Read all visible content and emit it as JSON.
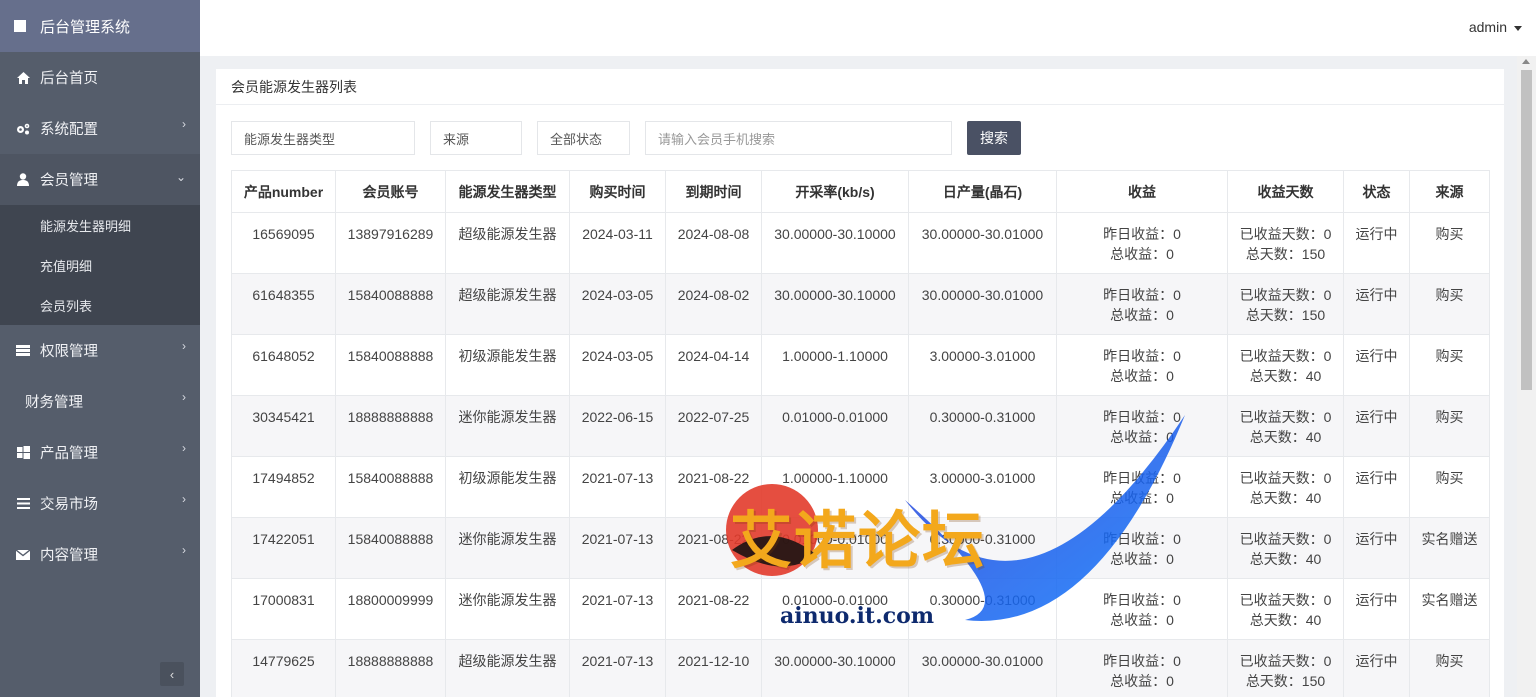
{
  "sidebar": {
    "brand": "后台管理系统",
    "items": [
      {
        "label": "后台首页",
        "icon": "home-icon",
        "chevron": false
      },
      {
        "label": "系统配置",
        "icon": "gears-icon",
        "chevron": true
      },
      {
        "label": "会员管理",
        "icon": "user-icon",
        "chevron": true,
        "open": true
      },
      {
        "label": "权限管理",
        "icon": "list-icon",
        "chevron": true
      },
      {
        "label": "财务管理",
        "icon": "",
        "chevron": true
      },
      {
        "label": "产品管理",
        "icon": "windows-icon",
        "chevron": true
      },
      {
        "label": "交易市场",
        "icon": "bars-icon",
        "chevron": true
      },
      {
        "label": "内容管理",
        "icon": "envelope-icon",
        "chevron": true
      }
    ],
    "sub_items": [
      "能源发生器明细",
      "充值明细",
      "会员列表"
    ],
    "collapse_symbol": "‹"
  },
  "header": {
    "user": "admin"
  },
  "panel": {
    "title": "会员能源发生器列表"
  },
  "filters": {
    "type": "能源发生器类型",
    "source": "来源",
    "status": "全部状态",
    "search_placeholder": "请输入会员手机搜索",
    "search_button": "搜索"
  },
  "table": {
    "columns": [
      "产品number",
      "会员账号",
      "能源发生器类型",
      "购买时间",
      "到期时间",
      "开采率(kb/s)",
      "日产量(晶石)",
      "收益",
      "收益天数",
      "状态",
      "来源"
    ],
    "rows": [
      {
        "number": "16569095",
        "account": "13897916289",
        "type": "超级能源发生器",
        "buy": "2024-03-11",
        "expire": "2024-08-08",
        "rate": "30.00000-30.10000",
        "daily": "30.00000-30.01000",
        "yesterday": "昨日收益：0",
        "total": "总收益：0",
        "days_done": "已收益天数：0",
        "days_total": "总天数：150",
        "status": "运行中",
        "source": "购买"
      },
      {
        "number": "61648355",
        "account": "15840088888",
        "type": "超级能源发生器",
        "buy": "2024-03-05",
        "expire": "2024-08-02",
        "rate": "30.00000-30.10000",
        "daily": "30.00000-30.01000",
        "yesterday": "昨日收益：0",
        "total": "总收益：0",
        "days_done": "已收益天数：0",
        "days_total": "总天数：150",
        "status": "运行中",
        "source": "购买"
      },
      {
        "number": "61648052",
        "account": "15840088888",
        "type": "初级源能发生器",
        "buy": "2024-03-05",
        "expire": "2024-04-14",
        "rate": "1.00000-1.10000",
        "daily": "3.00000-3.01000",
        "yesterday": "昨日收益：0",
        "total": "总收益：0",
        "days_done": "已收益天数：0",
        "days_total": "总天数：40",
        "status": "运行中",
        "source": "购买"
      },
      {
        "number": "30345421",
        "account": "18888888888",
        "type": "迷你能源发生器",
        "buy": "2022-06-15",
        "expire": "2022-07-25",
        "rate": "0.01000-0.01000",
        "daily": "0.30000-0.31000",
        "yesterday": "昨日收益：0",
        "total": "总收益：0",
        "days_done": "已收益天数：0",
        "days_total": "总天数：40",
        "status": "运行中",
        "source": "购买"
      },
      {
        "number": "17494852",
        "account": "15840088888",
        "type": "初级源能发生器",
        "buy": "2021-07-13",
        "expire": "2021-08-22",
        "rate": "1.00000-1.10000",
        "daily": "3.00000-3.01000",
        "yesterday": "昨日收益：0",
        "total": "总收益：0",
        "days_done": "已收益天数：0",
        "days_total": "总天数：40",
        "status": "运行中",
        "source": "购买"
      },
      {
        "number": "17422051",
        "account": "15840088888",
        "type": "迷你能源发生器",
        "buy": "2021-07-13",
        "expire": "2021-08-22",
        "rate": "0.01000-0.01000",
        "daily": "0.30000-0.31000",
        "yesterday": "昨日收益：0",
        "total": "总收益：0",
        "days_done": "已收益天数：0",
        "days_total": "总天数：40",
        "status": "运行中",
        "source": "实名赠送"
      },
      {
        "number": "17000831",
        "account": "18800009999",
        "type": "迷你能源发生器",
        "buy": "2021-07-13",
        "expire": "2021-08-22",
        "rate": "0.01000-0.01000",
        "daily": "0.30000-0.31000",
        "yesterday": "昨日收益：0",
        "total": "总收益：0",
        "days_done": "已收益天数：0",
        "days_total": "总天数：40",
        "status": "运行中",
        "source": "实名赠送"
      },
      {
        "number": "14779625",
        "account": "18888888888",
        "type": "超级能源发生器",
        "buy": "2021-07-13",
        "expire": "2021-12-10",
        "rate": "30.00000-30.10000",
        "daily": "30.00000-30.01000",
        "yesterday": "昨日收益：0",
        "total": "总收益：0",
        "days_done": "已收益天数：0",
        "days_total": "总天数：150",
        "status": "运行中",
        "source": "购买"
      }
    ]
  },
  "watermark": {
    "title": "艾诺论坛",
    "url": "ainuo.it.com"
  }
}
